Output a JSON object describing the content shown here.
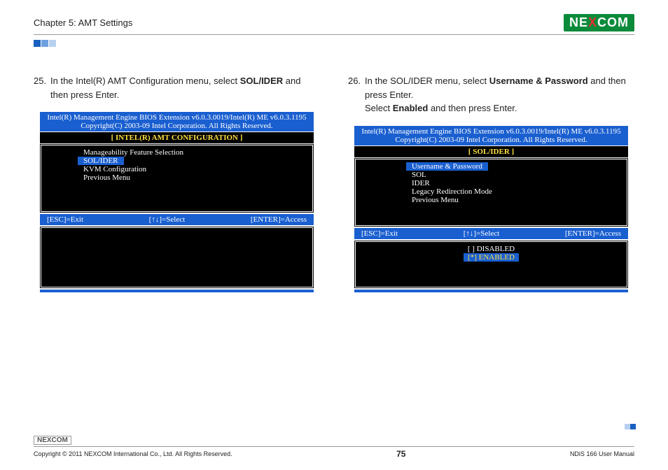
{
  "header": {
    "chapter": "Chapter 5: AMT Settings",
    "logo_pre": "NE",
    "logo_x": "X",
    "logo_post": "COM"
  },
  "left_step": {
    "num": "25.",
    "text_a": "In the Intel(R) AMT Configuration menu, select ",
    "text_bold": "SOL/IDER",
    "text_b": " and then press Enter."
  },
  "right_step": {
    "num": "26.",
    "text_a": "In the SOL/IDER menu, select ",
    "text_bold1": "Username & Password",
    "text_b": " and then press Enter.",
    "text_c": "Select ",
    "text_bold2": "Enabled",
    "text_d": " and then press Enter."
  },
  "bios_common": {
    "header_line1": "Intel(R) Management Engine BIOS Extension v6.0.3.0019/Intel(R) ME v6.0.3.1195",
    "header_line2": "Copyright(C) 2003-09 Intel Corporation. All Rights Reserved.",
    "hint_esc": "[ESC]=Exit",
    "hint_sel": "[↑↓]=Select",
    "hint_enter": "[ENTER]=Access"
  },
  "bios_left": {
    "title": "[    INTEL(R) AMT CONFIGURATION    ]",
    "item1": "Manageability Feature Selection",
    "item_sel": "SOL/IDER",
    "item3": "KVM Configuration",
    "item4": "Previous Menu"
  },
  "bios_right": {
    "title": "[    SOL/IDER    ]",
    "item_sel": "Username & Password",
    "item2": "SOL",
    "item3": "IDER",
    "item4": "Legacy Redirection Mode",
    "item5": "Previous Menu",
    "opt_disabled": "[   ] DISABLED",
    "opt_enabled": "[*] ENABLED"
  },
  "footer": {
    "logo": "NEXCOM",
    "copyright": "Copyright © 2011 NEXCOM International Co., Ltd. All Rights Reserved.",
    "page": "75",
    "manual": "NDiS 166 User Manual"
  }
}
